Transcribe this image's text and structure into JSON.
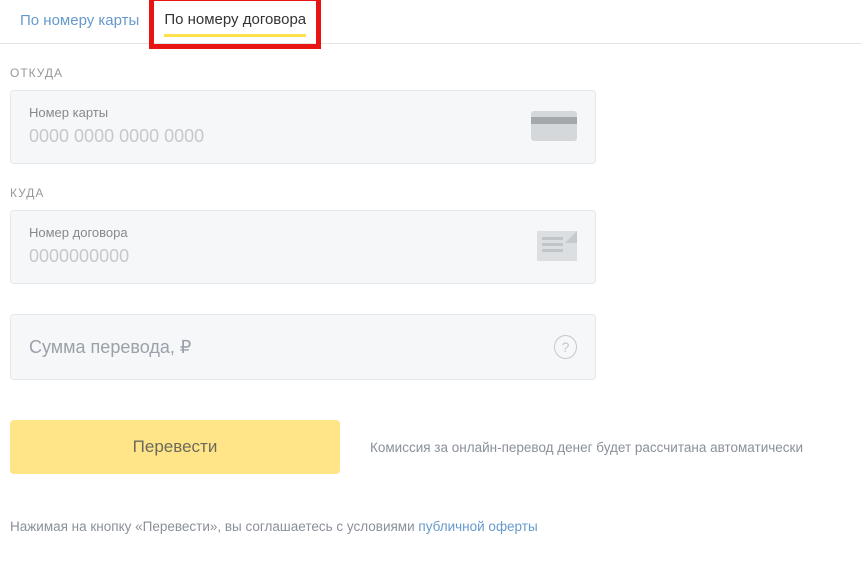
{
  "tabs": {
    "byCard": "По номеру карты",
    "byContract": "По номеру договора"
  },
  "from": {
    "sectionLabel": "ОТКУДА",
    "label": "Номер карты",
    "placeholder": "0000 0000 0000 0000"
  },
  "to": {
    "sectionLabel": "КУДА",
    "label": "Номер договора",
    "placeholder": "0000000000"
  },
  "amount": {
    "placeholder": "Сумма перевода, ₽"
  },
  "action": {
    "button": "Перевести",
    "commission": "Комиссия за онлайн-перевод денег будет рассчитана автоматически"
  },
  "disclaimer": {
    "text": "Нажимая на кнопку «Перевести», вы соглашаетесь с условиями ",
    "link": "публичной оферты"
  }
}
